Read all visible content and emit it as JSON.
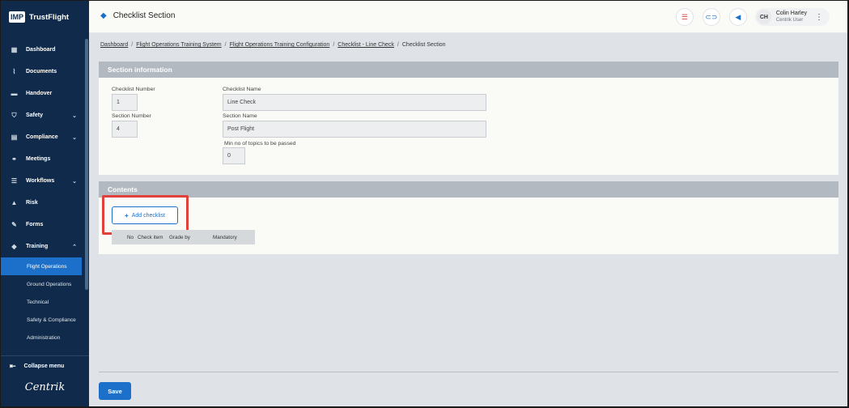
{
  "app": {
    "logo_box": "IMP",
    "logo_text": "TrustFlight",
    "brand": "Centrik"
  },
  "sidebar": {
    "items": [
      {
        "label": "Dashboard",
        "icon": "dashboard-icon",
        "glyph": "▦",
        "has_chevron": false
      },
      {
        "label": "Documents",
        "icon": "paperclip-icon",
        "glyph": "⌇",
        "has_chevron": false
      },
      {
        "label": "Handover",
        "icon": "handover-icon",
        "glyph": "▬",
        "has_chevron": false
      },
      {
        "label": "Safety",
        "icon": "shield-icon",
        "glyph": "⛉",
        "has_chevron": true
      },
      {
        "label": "Compliance",
        "icon": "clipboard-icon",
        "glyph": "▤",
        "has_chevron": true
      },
      {
        "label": "Meetings",
        "icon": "meetings-icon",
        "glyph": "⚭",
        "has_chevron": false
      },
      {
        "label": "Workflows",
        "icon": "workflows-icon",
        "glyph": "☰",
        "has_chevron": true
      },
      {
        "label": "Risk",
        "icon": "warning-icon",
        "glyph": "▲",
        "has_chevron": false
      },
      {
        "label": "Forms",
        "icon": "forms-icon",
        "glyph": "✎",
        "has_chevron": false
      },
      {
        "label": "Training",
        "icon": "graduation-cap-icon",
        "glyph": "◆",
        "has_chevron": true,
        "chevron": "⌃"
      }
    ],
    "training_sub": [
      {
        "label": "Flight Operations",
        "active": true
      },
      {
        "label": "Ground Operations",
        "active": false
      },
      {
        "label": "Technical",
        "active": false
      },
      {
        "label": "Safety & Compliance",
        "active": false
      },
      {
        "label": "Administration",
        "active": false
      }
    ],
    "collapse_label": "Collapse menu"
  },
  "header": {
    "title": "Checklist Section",
    "user_initials": "CH",
    "user_name": "Colin Harley",
    "user_role": "Centrik User"
  },
  "breadcrumb": {
    "items": [
      "Dashboard",
      "Flight Operations Training System",
      "Flight Operations Training Configuration",
      "Checklist - Line Check"
    ],
    "current": "Checklist Section"
  },
  "section_info": {
    "heading": "Section information",
    "checklist_number_label": "Checklist Number",
    "checklist_number": "1",
    "section_number_label": "Section Number",
    "section_number": "4",
    "checklist_name_label": "Checklist Name",
    "checklist_name": "Line Check",
    "section_name_label": "Section Name",
    "section_name": "Post Flight",
    "min_topics_label": "Min no of topics to be passed",
    "min_topics": "0"
  },
  "contents": {
    "heading": "Contents",
    "add_label": "Add checklist",
    "columns": [
      "No",
      "Check item",
      "Grade by",
      "Mandatory"
    ]
  },
  "footer": {
    "save_label": "Save"
  }
}
